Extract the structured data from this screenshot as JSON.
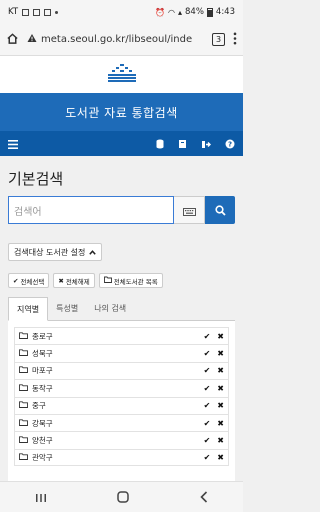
{
  "status_bar": {
    "carrier": "KT",
    "battery": "84%",
    "time": "4:43"
  },
  "browser": {
    "url": "meta.seoul.go.kr/libseoul/inde",
    "tab_count": "3"
  },
  "header": {
    "title": "도서관 자료 통합검색"
  },
  "page": {
    "heading": "기본검색",
    "search_placeholder": "검색어",
    "scope_button": "검색대상 도서관 설정",
    "select_all": "전체선택",
    "deselect_all": "전체해제",
    "all_libraries": "전체도서관 목록"
  },
  "tabs": [
    {
      "label": "지역별"
    },
    {
      "label": "특성별"
    },
    {
      "label": "나의 검색"
    }
  ],
  "districts": [
    {
      "name": "종로구"
    },
    {
      "name": "성북구"
    },
    {
      "name": "마포구"
    },
    {
      "name": "동작구"
    },
    {
      "name": "중구"
    },
    {
      "name": "강북구"
    },
    {
      "name": "양천구"
    },
    {
      "name": "관악구"
    }
  ],
  "colors": {
    "header_blue": "#1e6bb8",
    "nav_blue": "#0d5aa5"
  }
}
